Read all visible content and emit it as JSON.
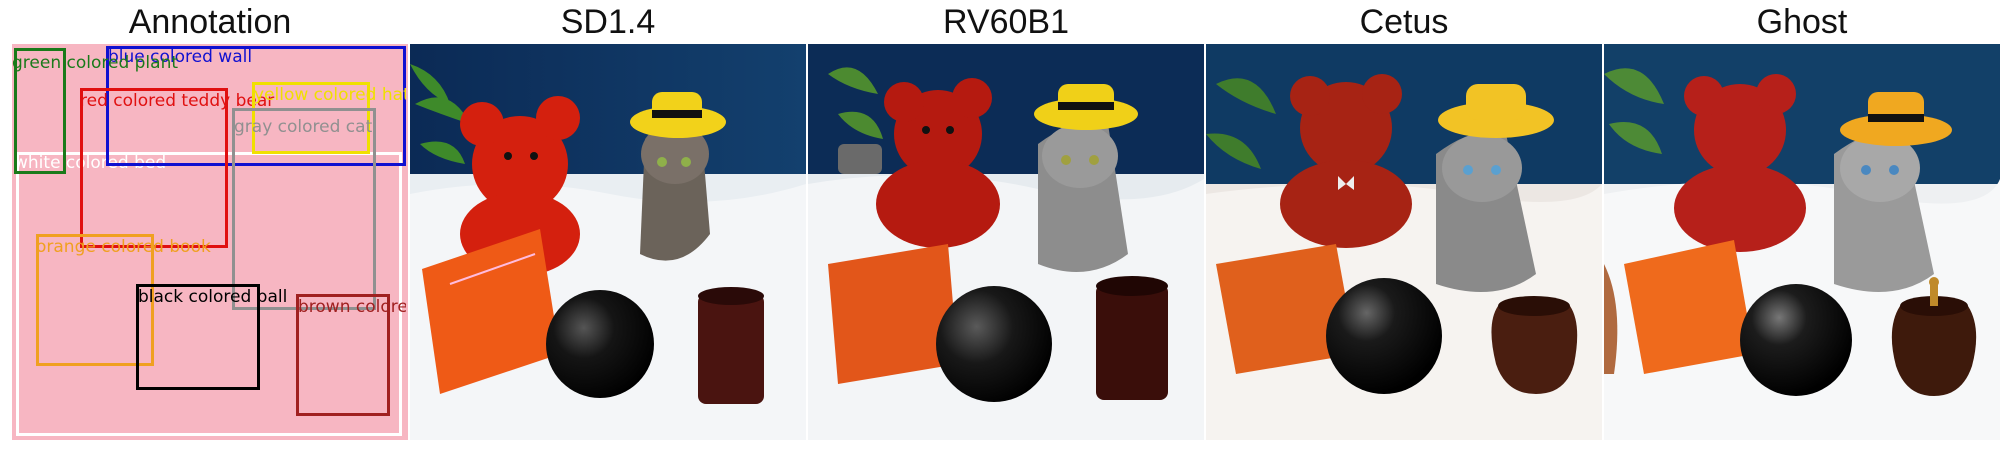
{
  "columns": [
    {
      "title": "Annotation"
    },
    {
      "title": "SD1.4"
    },
    {
      "title": "RV60B1"
    },
    {
      "title": "Cetus"
    },
    {
      "title": "Ghost"
    }
  ],
  "annotation": {
    "background_color": "#f7b6c2",
    "boxes": [
      {
        "label": "white colored bed",
        "color": "#ffffff"
      },
      {
        "label": "blue colored wall",
        "color": "#1010d0"
      },
      {
        "label": "green colored plant",
        "color": "#1a7a1a"
      },
      {
        "label": "red colored teddy bear",
        "color": "#e01010"
      },
      {
        "label": "yellow colored hat",
        "color": "#f0e000"
      },
      {
        "label": "gray colored cat",
        "color": "#909090"
      },
      {
        "label": "orange colored book",
        "color": "#f0a020"
      },
      {
        "label": "black colored ball",
        "color": "#000000"
      },
      {
        "label": "brown colored cup",
        "color": "#a02020"
      }
    ]
  }
}
